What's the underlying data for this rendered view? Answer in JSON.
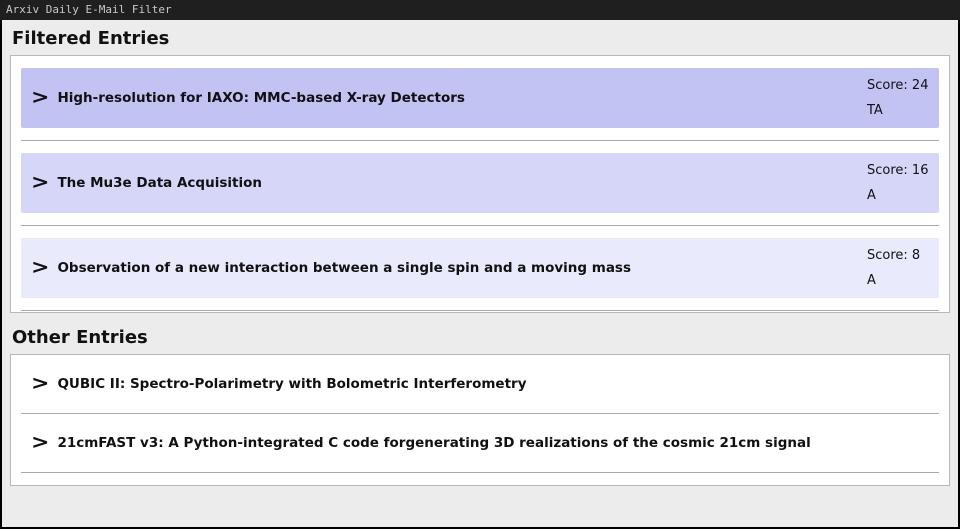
{
  "window": {
    "title": "Arxiv Daily E-Mail Filter"
  },
  "sections": {
    "filtered": {
      "heading": "Filtered Entries",
      "entries": [
        {
          "title": "High-resolution for IAXO: MMC-based X-ray Detectors",
          "score_label": "Score: 24",
          "flag": "TA",
          "bg": "#c2c3f3"
        },
        {
          "title": "The Mu3e Data Acquisition",
          "score_label": "Score: 16",
          "flag": "A",
          "bg": "#d6d7f8"
        },
        {
          "title": "Observation of a new interaction between a single spin and a moving mass",
          "score_label": "Score: 8",
          "flag": "A",
          "bg": "#e9eafc"
        }
      ]
    },
    "other": {
      "heading": "Other Entries",
      "entries": [
        {
          "title": "QUBIC II: Spectro-Polarimetry with Bolometric Interferometry",
          "score_label": "",
          "flag": "",
          "bg": "#ffffff"
        },
        {
          "title": "21cmFAST v3: A Python-integrated C code forgenerating 3D realizations of the cosmic 21cm signal",
          "score_label": "",
          "flag": "",
          "bg": "#ffffff"
        }
      ]
    }
  }
}
